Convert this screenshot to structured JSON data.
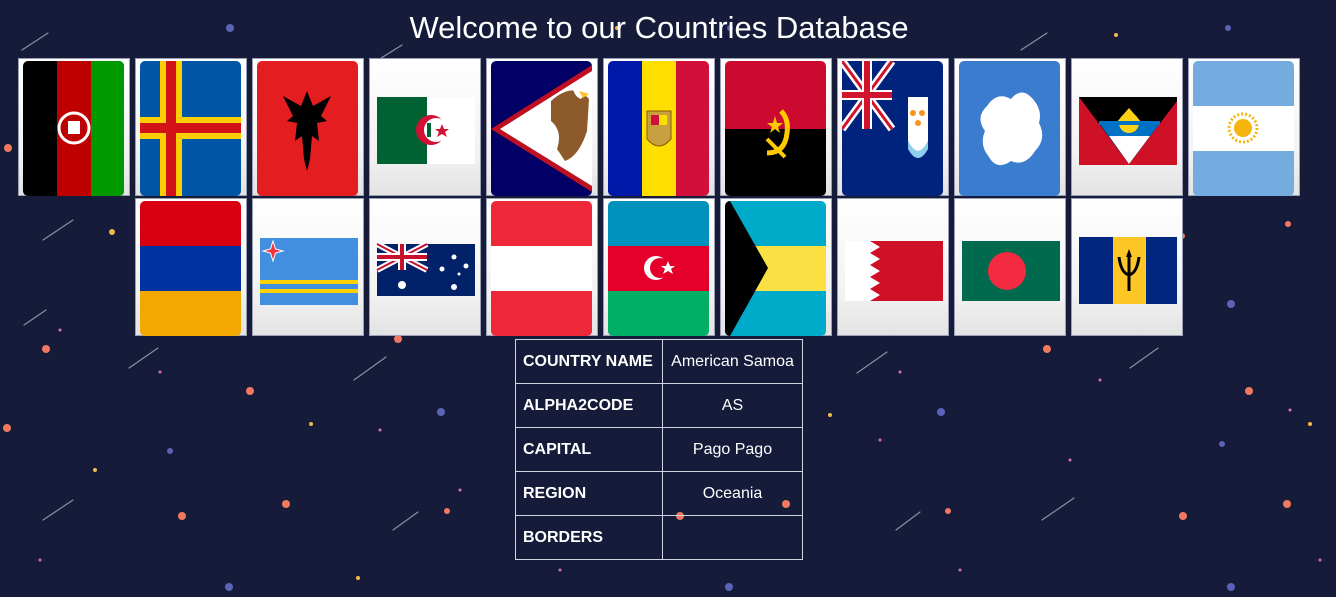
{
  "page": {
    "title": "Welcome to our Countries Database"
  },
  "flags": [
    {
      "id": "flag-afghanistan",
      "icon": "afghanistan-flag-icon"
    },
    {
      "id": "flag-aland",
      "icon": "aland-islands-flag-icon"
    },
    {
      "id": "flag-albania",
      "icon": "albania-flag-icon"
    },
    {
      "id": "flag-algeria",
      "icon": "algeria-flag-icon"
    },
    {
      "id": "flag-american-samoa",
      "icon": "american-samoa-flag-icon"
    },
    {
      "id": "flag-andorra",
      "icon": "andorra-flag-icon"
    },
    {
      "id": "flag-angola",
      "icon": "angola-flag-icon"
    },
    {
      "id": "flag-anguilla",
      "icon": "anguilla-flag-icon"
    },
    {
      "id": "flag-antarctica",
      "icon": "antarctica-flag-icon"
    },
    {
      "id": "flag-antigua-barbuda",
      "icon": "antigua-barbuda-flag-icon"
    },
    {
      "id": "flag-argentina",
      "icon": "argentina-flag-icon"
    },
    {
      "id": "flag-armenia",
      "icon": "armenia-flag-icon"
    },
    {
      "id": "flag-aruba",
      "icon": "aruba-flag-icon"
    },
    {
      "id": "flag-australia",
      "icon": "australia-flag-icon"
    },
    {
      "id": "flag-austria",
      "icon": "austria-flag-icon"
    },
    {
      "id": "flag-azerbaijan",
      "icon": "azerbaijan-flag-icon"
    },
    {
      "id": "flag-bahamas",
      "icon": "bahamas-flag-icon"
    },
    {
      "id": "flag-bahrain",
      "icon": "bahrain-flag-icon"
    },
    {
      "id": "flag-bangladesh",
      "icon": "bangladesh-flag-icon"
    },
    {
      "id": "flag-barbados",
      "icon": "barbados-flag-icon"
    }
  ],
  "details": {
    "rows": [
      {
        "key": "COUNTRY NAME",
        "value": "American Samoa"
      },
      {
        "key": "ALPHA2CODE",
        "value": "AS"
      },
      {
        "key": "CAPITAL",
        "value": "Pago Pago"
      },
      {
        "key": "REGION",
        "value": "Oceania"
      },
      {
        "key": "BORDERS",
        "value": ""
      }
    ]
  },
  "colors": {
    "background": "#161b3a",
    "card_border": "#9aa0b3"
  }
}
